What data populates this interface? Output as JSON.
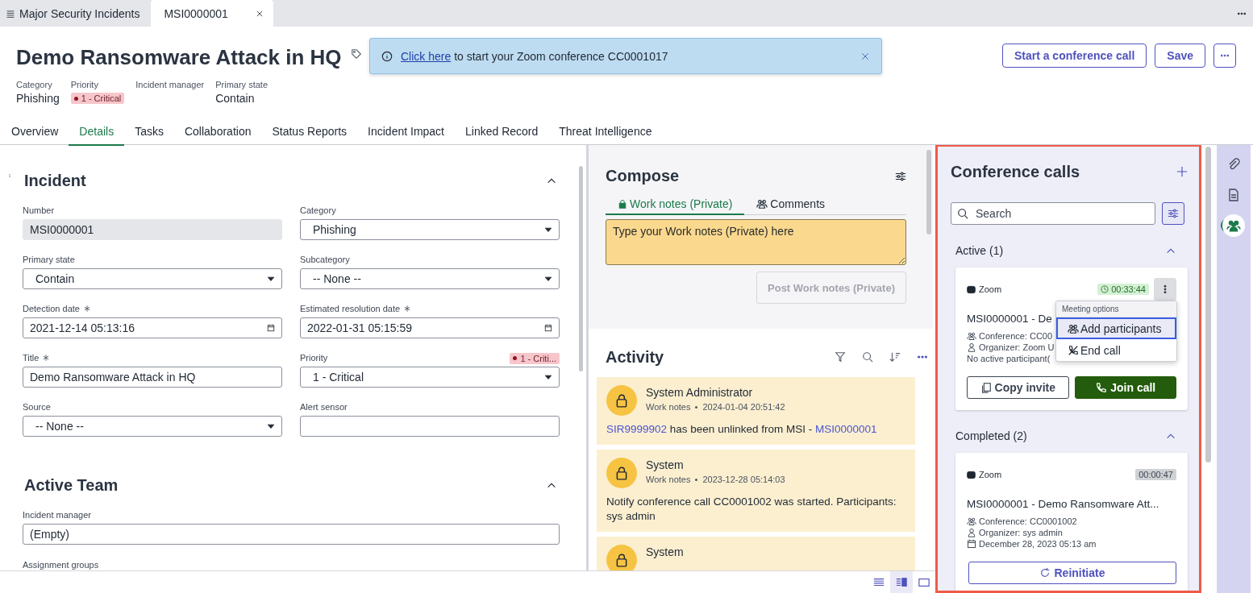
{
  "window_tabs": [
    {
      "label": "Major Security Incidents",
      "kind": "list",
      "selected": false
    },
    {
      "label": "MSI0000001",
      "kind": "record",
      "selected": true
    }
  ],
  "header": {
    "title": "Demo Ransomware Attack in HQ",
    "meta": [
      {
        "label": "Category",
        "value": "Phishing",
        "kind": "text"
      },
      {
        "label": "Priority",
        "value": "1 - Critical",
        "kind": "badge"
      },
      {
        "label": "Incident manager"
      },
      {
        "label": "Primary state",
        "value": "Contain",
        "kind": "text"
      }
    ],
    "buttons": [
      "Start a conference call",
      "Save"
    ]
  },
  "toast": {
    "link": "Click here",
    "text": "to start your Zoom conference CC0001017"
  },
  "tabs": [
    {
      "label": "Overview",
      "selected": false
    },
    {
      "label": "Details",
      "selected": true
    },
    {
      "label": "Tasks",
      "selected": false
    },
    {
      "label": "Collaboration",
      "selected": false
    },
    {
      "label": "Status Reports",
      "selected": false
    },
    {
      "label": "Incident Impact",
      "selected": false
    },
    {
      "label": "Linked Record",
      "selected": false
    },
    {
      "label": "Threat Intelligence",
      "selected": false
    }
  ],
  "form": {
    "sections": [
      {
        "title": "Incident",
        "expanded": true,
        "fields": [
          {
            "label": "Number",
            "value": "MSI0000001",
            "kind": "readonly",
            "required": false
          },
          {
            "label": "Category",
            "value": "Phishing",
            "kind": "select",
            "required": false
          },
          {
            "label": "Primary state",
            "value": "Contain",
            "kind": "select",
            "required": false
          },
          {
            "label": "Subcategory",
            "value": "-- None --",
            "kind": "select",
            "required": false
          },
          {
            "label": "Detection date",
            "value": "2021-12-14 05:13:16",
            "kind": "date",
            "required": true
          },
          {
            "label": "Estimated resolution date",
            "value": "2022-01-31 05:15:59",
            "kind": "date",
            "required": true
          },
          {
            "label": "Title",
            "value": "Demo Ransomware Attack in HQ",
            "kind": "text",
            "required": true
          },
          {
            "label": "Priority",
            "value": "1 - Critical",
            "kind": "select",
            "required": false,
            "badge": "1 - Criti..."
          },
          {
            "label": "Source",
            "value": "-- None --",
            "kind": "select",
            "required": false
          },
          {
            "label": "Alert sensor",
            "kind": "text",
            "required": false
          }
        ]
      },
      {
        "title": "Active Team",
        "expanded": true,
        "fields": [
          {
            "label": "Incident manager",
            "value": "(Empty)",
            "kind": "wide",
            "required": false
          }
        ]
      }
    ],
    "trailing_label": "Assignment groups"
  },
  "compose": {
    "title": "Compose",
    "tabs": [
      {
        "label": "Work notes (Private)",
        "kind": "private",
        "selected": true
      },
      {
        "label": "Comments",
        "kind": "public",
        "selected": false
      }
    ],
    "placeholder": "Type your Work notes (Private) here",
    "post_button": {
      "label": "Post Work notes (Private)",
      "disabled": true
    }
  },
  "activity": {
    "title": "Activity",
    "entries": [
      {
        "author": "System Administrator",
        "type": "Work notes",
        "time": "2024-01-04 20:51:42",
        "body": [
          {
            "text": "SIR9999902",
            "link": true
          },
          {
            "text": "has been unlinked from MSI -",
            "link": false
          },
          {
            "text": "MSI0000001",
            "link": true
          }
        ]
      },
      {
        "author": "System",
        "type": "Work notes",
        "time": "2023-12-28 05:14:03",
        "body": [
          {
            "text": "Notify conference call CC0001002 was started. Participants: sys admin",
            "link": false
          }
        ]
      },
      {
        "author": "System"
      }
    ]
  },
  "conference": {
    "title": "Conference calls",
    "search": {
      "placeholder": "Search"
    },
    "groups": [
      {
        "title": "Active (1)",
        "expanded": true,
        "calls": [
          {
            "provider": "Zoom",
            "duration": "00:33:44",
            "running": true,
            "title": "MSI0000001 - De",
            "details": [
              {
                "kind": "conference",
                "text": "Conference: CC00"
              },
              {
                "kind": "organizer",
                "text": "Organizer: Zoom U"
              },
              {
                "kind": "participants",
                "text": "No active participant("
              }
            ],
            "menu": {
              "title": "Meeting options",
              "items": [
                {
                  "label": "Add participants",
                  "kind": "add",
                  "selected": true
                },
                {
                  "label": "End call",
                  "kind": "end",
                  "selected": false
                }
              ]
            },
            "buttons": [
              {
                "label": "Copy invite",
                "kind": "copy"
              },
              {
                "label": "Join call",
                "kind": "join"
              }
            ]
          }
        ]
      },
      {
        "title": "Completed (2)",
        "expanded": true,
        "calls": [
          {
            "provider": "Zoom",
            "duration": "00:00:47",
            "running": false,
            "title": "MSI0000001 - Demo Ransomware Att...",
            "details": [
              {
                "kind": "conference",
                "text": "Conference: CC0001002"
              },
              {
                "kind": "organizer",
                "text": "Organizer: sys admin"
              },
              {
                "kind": "date",
                "text": "December 28, 2023 05:13 am"
              }
            ],
            "buttons": [
              {
                "label": "Reinitiate",
                "kind": "reinitiate"
              }
            ]
          }
        ]
      }
    ]
  },
  "rail": [
    {
      "kind": "attachment",
      "selected": false
    },
    {
      "kind": "document",
      "selected": false
    },
    {
      "kind": "people",
      "selected": true
    }
  ],
  "view_modes": [
    {
      "kind": "list",
      "selected": false
    },
    {
      "kind": "split",
      "selected": true
    },
    {
      "kind": "single",
      "selected": false
    }
  ]
}
